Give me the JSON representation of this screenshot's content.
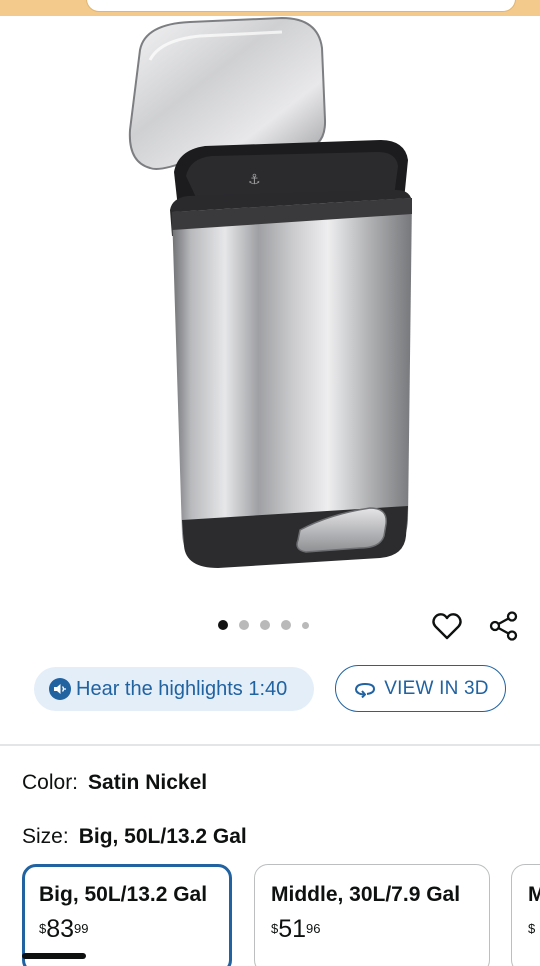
{
  "gallery": {
    "product_image_alt": "Stainless steel step trash can with open lid",
    "dots": [
      {
        "active": true,
        "small": false
      },
      {
        "active": false,
        "small": false
      },
      {
        "active": false,
        "small": false
      },
      {
        "active": false,
        "small": false
      },
      {
        "active": false,
        "small": true
      }
    ],
    "wishlist_icon": "heart-icon",
    "share_icon": "share-icon"
  },
  "actions": {
    "hear_highlights_label": "Hear the highlights 1:40",
    "view_3d_label": "VIEW IN 3D",
    "accent_color": "#2162a1",
    "hear_bg": "#e3eef9"
  },
  "attributes": {
    "color_label": "Color:",
    "color_value": "Satin Nickel",
    "size_label": "Size:",
    "size_value": "Big, 50L/13.2 Gal"
  },
  "size_options": [
    {
      "name": "Big, 50L/13.2 Gal",
      "currency": "$",
      "whole": "83",
      "fraction": "99",
      "selected": true
    },
    {
      "name": "Middle, 30L/7.9 Gal",
      "currency": "$",
      "whole": "51",
      "fraction": "96",
      "selected": false
    },
    {
      "name": "M",
      "currency": "$",
      "whole": "",
      "fraction": "",
      "selected": false
    }
  ]
}
